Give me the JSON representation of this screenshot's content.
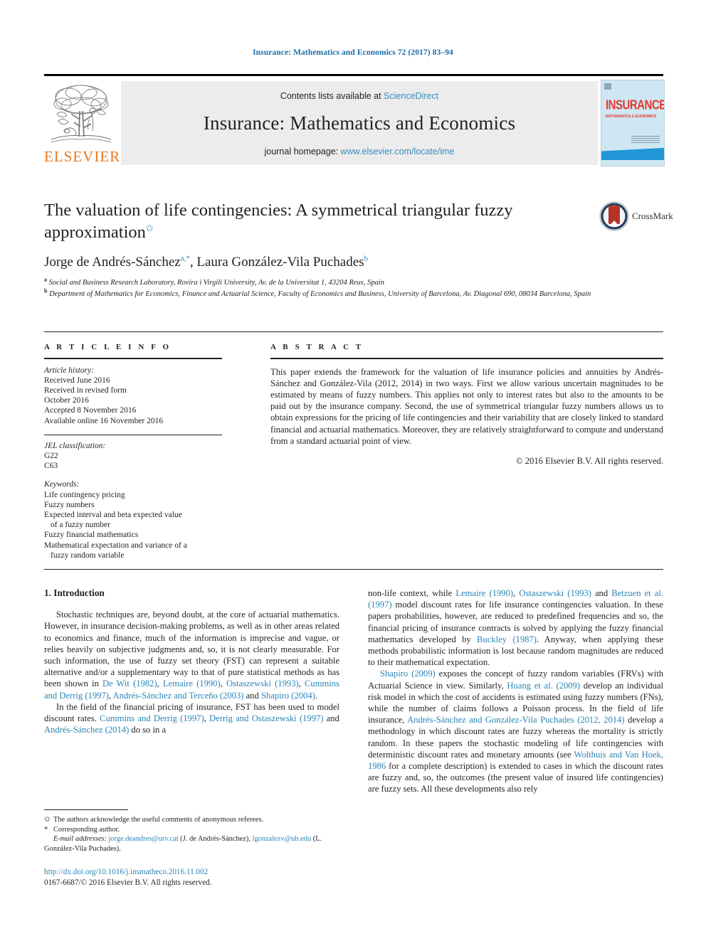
{
  "running_head": "Insurance: Mathematics and Economics 72 (2017) 83–94",
  "masthead": {
    "publisher_name": "ELSEVIER",
    "contents_prefix": "Contents lists available at ",
    "contents_link": "ScienceDirect",
    "journal_title": "Insurance: Mathematics and Economics",
    "homepage_prefix": "journal homepage: ",
    "homepage_link": "www.elsevier.com/locate/ime",
    "cover": {
      "title": "INSURANCE",
      "subtitle": "MATHEMATICS & ECONOMICS"
    }
  },
  "article": {
    "title": "The valuation of life contingencies: A symmetrical triangular fuzzy approximation",
    "title_footnote_marker": "✩",
    "authors": "Jorge de Andrés-Sánchez",
    "author_a_marks": "a,*",
    "author2": ", Laura González-Vila Puchades",
    "author_b_marks": "b",
    "affiliation_a_mark": "a",
    "affiliation_a": " Social and Business Research Laboratory, Rovira i Virgili University, Av. de la Universitat 1, 43204 Reus, Spain",
    "affiliation_b_mark": "b",
    "affiliation_b": " Department of Mathematics for Economics, Finance and Actuarial Science, Faculty of Economics and Business, University of Barcelona, Av. Diagonal 690, 08034 Barcelona, Spain",
    "crossmark_label": "CrossMark"
  },
  "article_info": {
    "heading": "A R T I C L E    I N F O",
    "history_label": "Article history:",
    "history": [
      "Received June 2016",
      "Received in revised form",
      "October 2016",
      "Accepted 8 November 2016",
      "Available online 16 November 2016"
    ],
    "jel_label": "JEL classification:",
    "jel": [
      "G22",
      "C63"
    ],
    "keywords_label": "Keywords:",
    "keywords": [
      "Life contingency pricing",
      "Fuzzy numbers",
      "Expected interval and beta expected value",
      "of a fuzzy number",
      "Fuzzy financial mathematics",
      "Mathematical expectation and variance of a",
      "fuzzy random variable"
    ]
  },
  "abstract": {
    "heading": "A B S T R A C T",
    "text": "This paper extends the framework for the valuation of life insurance policies and annuities by Andrés-Sánchez and González-Vila (2012, 2014) in two ways. First we allow various uncertain magnitudes to be estimated by means of fuzzy numbers. This applies not only to interest rates but also to the amounts to be paid out by the insurance company. Second, the use of symmetrical triangular fuzzy numbers allows us to obtain expressions for the pricing of life contingencies and their variability that are closely linked to standard financial and actuarial mathematics. Moreover, they are relatively straightforward to compute and understand from a standard actuarial point of view.",
    "copyright": "© 2016 Elsevier B.V. All rights reserved."
  },
  "body": {
    "section_heading": "1. Introduction",
    "left_paragraph_1_pre": "Stochastic techniques are, beyond doubt, at the core of actuarial mathematics. However, in insurance decision-making problems, as well as in other areas related to economics and finance, much of the information is imprecise and vague, or relies heavily on subjective judgments and, so, it is not clearly measurable. For such information, the use of fuzzy set theory (FST) can represent a suitable alternative and/or a supplementary way to that of pure statistical methods as has been shown in ",
    "ref_dewit": "De Wit",
    "ref_dewit_year": "(1982)",
    "ref_lemaire": "Lemaire",
    "ref_lemaire_year": "(1990)",
    "ref_ostaszewski": "Ostaszewski",
    "ref_ostaszewski_year": "(1993)",
    "ref_cummins": "Cummins and Derrig",
    "ref_cummins_year": "(1997)",
    "ref_andres_tercено": "Andrés-Sánchez and Terceño",
    "ref_andres_terceno_year": "(2003)",
    "ref_shapiro2004": "Shapiro",
    "ref_shapiro2004_year": "(2004)",
    "left_paragraph_2_pre": "In the field of the financial pricing of insurance, FST has been used to model discount rates. ",
    "ref_derrig_ost": "Derrig and Ostaszewski",
    "ref_derrig_ost_year": "(1997)",
    "ref_andres2014": "Andrés-Sánchez",
    "ref_andres2014_year": "(2014)",
    "left_paragraph_2_post": " do so in a",
    "right_paragraph_1_pre": "non-life context, while ",
    "ref_betzuen": "Betzuen et al.",
    "ref_betzuen_year": "(1997)",
    "right_paragraph_1_mid": " model discount rates for life insurance contingencies valuation. In these papers probabilities, however, are reduced to predefined frequencies and so, the financial pricing of insurance contracts is solved by applying the fuzzy financial mathematics developed by ",
    "ref_buckley": "Buckley",
    "ref_buckley_year": "(1987)",
    "right_paragraph_1_post": ". Anyway, when applying these methods probabilistic information is lost because random magnitudes are reduced to their mathematical expectation.",
    "ref_shapiro2009": "Shapiro",
    "ref_shapiro2009_year": "(2009)",
    "right_paragraph_2_mid": " exposes the concept of fuzzy random variables (FRVs) with Actuarial Science in view. Similarly, ",
    "ref_huang": "Huang et al. (2009)",
    "right_paragraph_2_mid2": " develop an individual risk model in which the cost of accidents is estimated using fuzzy numbers (FNs), while the number of claims follows a Poisson process. In the field of life insurance, ",
    "ref_andres_gonzalez": "Andrés-Sánchez and González-Vila Puchades (2012, 2014)",
    "right_paragraph_2_mid3": " develop a methodology in which discount rates are fuzzy whereas the mortality is strictly random. In these papers the stochastic modeling of life contingencies with deterministic discount rates and monetary amounts (see ",
    "ref_wolthuis": "Wolthuis and Van Hoek, 1986",
    "right_paragraph_2_post": " for a complete description) is extended to cases in which the discount rates are fuzzy and, so, the outcomes (the present value of insured life contingencies) are fuzzy sets. All these developments also rely"
  },
  "footnotes": {
    "star_mark": "✩",
    "star_text": "The authors acknowledge the useful comments of anonymous referees.",
    "asterisk_mark": "*",
    "asterisk_text": "Corresponding author.",
    "email_label": "E-mail addresses:",
    "email_1": "jorge.deandres@urv.cat",
    "email_1_owner": " (J. de Andrés-Sánchez),",
    "email_2": "lgonzalezv@ub.edu",
    "email_2_owner": " (L. González-Vila Puchades)."
  },
  "doi_block": {
    "doi": "http://dx.doi.org/10.1016/j.insmatheco.2016.11.002",
    "issn_line": "0167-6687/© 2016 Elsevier B.V. All rights reserved."
  },
  "colors": {
    "link_blue": "#2a84b5",
    "sciencedirect_blue": "#3a8bbb",
    "elsevier_orange": "#E87722",
    "banner_grey": "#ececec",
    "cover_blue": "#cfe7f3",
    "cover_red": "#e8392e"
  }
}
